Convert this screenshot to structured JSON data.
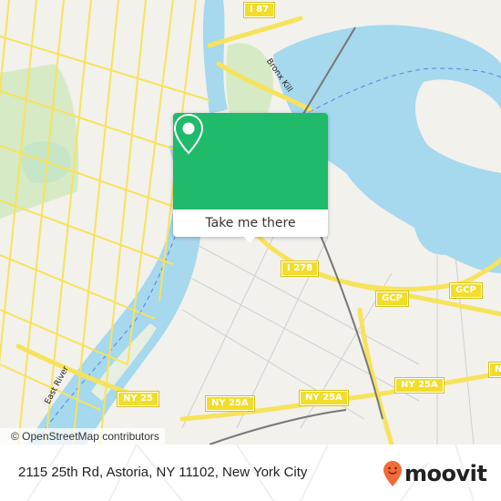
{
  "map": {
    "colors": {
      "land": "#f2f1ec",
      "water": "#a6d8ee",
      "park": "#cfe8bd",
      "road_major": "#f7e35b",
      "road_minor": "#ffffff",
      "rail": "#777777",
      "accent": "#1fba6a"
    },
    "labels": {
      "water_east_river": "East River",
      "water_bronx_kill": "Bronx Kill"
    },
    "shields": {
      "i87": "I 87",
      "i278": "I 278",
      "gcp_1": "GCP",
      "gcp_2": "GCP",
      "ny25": "NY 25",
      "ny25a_1": "NY 25A",
      "ny25a_2": "NY 25A",
      "ny25a_3": "NY 25A",
      "partial_right": "N"
    },
    "attribution": "© OpenStreetMap contributors"
  },
  "popup": {
    "icon": "map-pin-icon",
    "button_label": "Take me there"
  },
  "footer": {
    "address": "2115 25th Rd, Astoria, NY 11102, New York City",
    "logo_text": "moovit",
    "logo_icon": "moovit-smiley-pin-icon",
    "logo_color": "#f26b38"
  }
}
